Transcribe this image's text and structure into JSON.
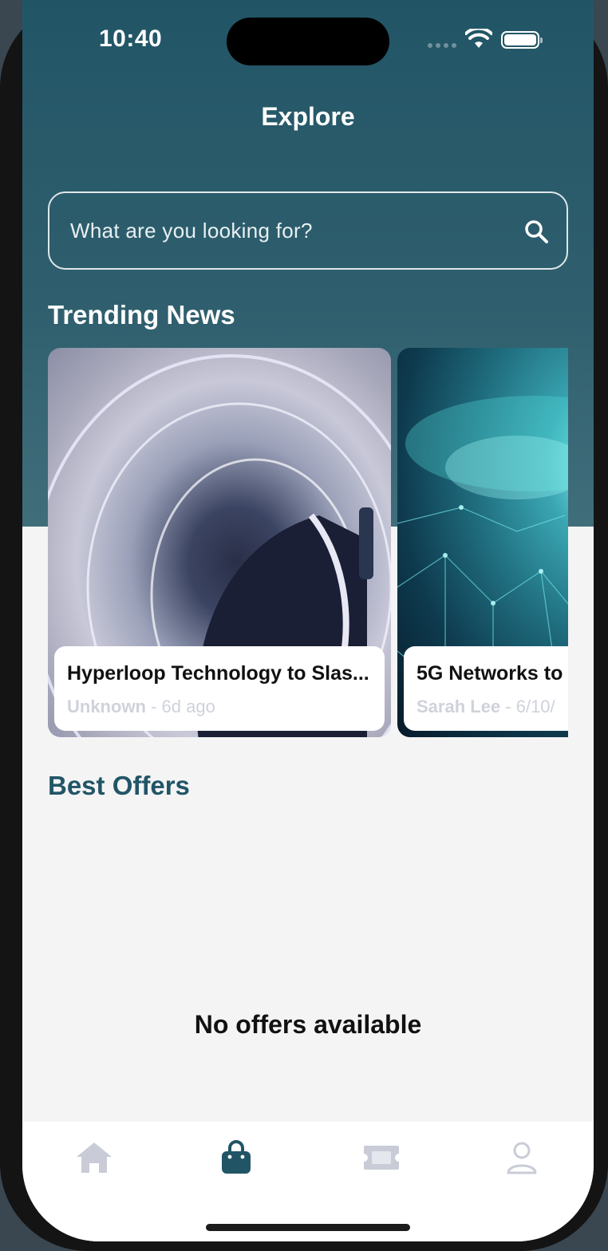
{
  "status_bar": {
    "time": "10:40"
  },
  "header": {
    "title": "Explore"
  },
  "search": {
    "placeholder": "What are you looking for?"
  },
  "trending": {
    "title": "Trending News",
    "cards": [
      {
        "title": "Hyperloop Technology to Slas...",
        "author": "Unknown",
        "time": " - 6d ago",
        "image": "hyperloop-tunnel"
      },
      {
        "title": "5G Networks to",
        "author": "Sarah Lee",
        "time": " - 6/10/",
        "image": "5g-network"
      }
    ]
  },
  "offers": {
    "title": "Best Offers",
    "empty_text": "No offers available"
  },
  "tabbar": {
    "tabs": [
      {
        "icon": "home-icon",
        "active": false
      },
      {
        "icon": "shopping-bag-icon",
        "active": true
      },
      {
        "icon": "ticket-icon",
        "active": false
      },
      {
        "icon": "user-icon",
        "active": false
      }
    ]
  },
  "colors": {
    "primary": "#215566",
    "inactive_icon": "#c9ccd7",
    "background": "#f4f4f5"
  }
}
